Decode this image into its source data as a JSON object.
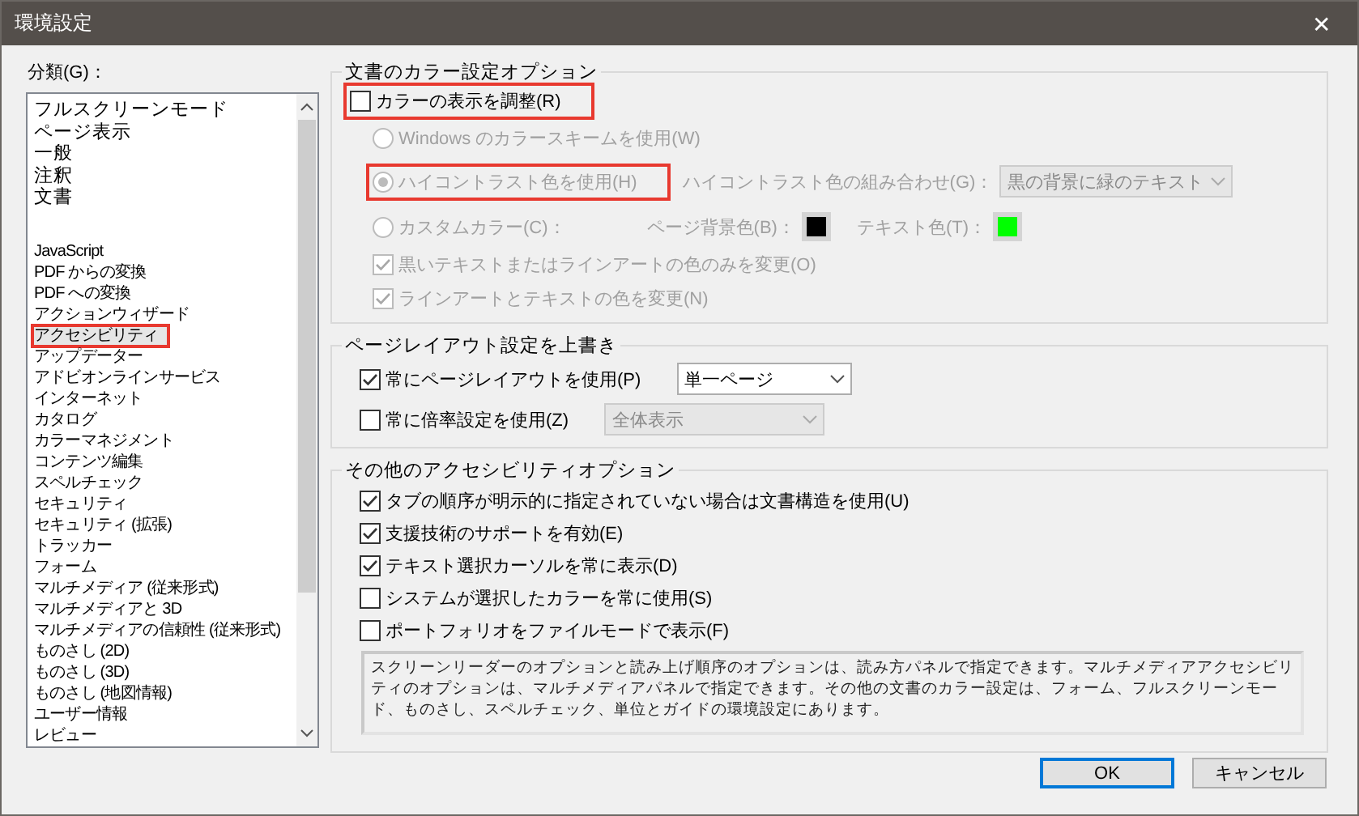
{
  "window": {
    "title": "環境設定",
    "close": "✕"
  },
  "category_label": "分類(G)：",
  "categories": [
    {
      "kind": "item",
      "label": "フルスクリーンモード",
      "selected": false,
      "highlighted": false
    },
    {
      "kind": "item",
      "label": "ページ表示",
      "selected": false,
      "highlighted": false
    },
    {
      "kind": "item",
      "label": "一般",
      "selected": false,
      "highlighted": false
    },
    {
      "kind": "item",
      "label": "注釈",
      "selected": false,
      "highlighted": false
    },
    {
      "kind": "item",
      "label": "文書",
      "selected": false,
      "highlighted": false
    },
    {
      "kind": "separator"
    },
    {
      "kind": "item",
      "label": "JavaScript",
      "selected": false,
      "highlighted": false
    },
    {
      "kind": "item",
      "label": "PDF からの変換",
      "selected": false,
      "highlighted": false
    },
    {
      "kind": "item",
      "label": "PDF への変換",
      "selected": false,
      "highlighted": false
    },
    {
      "kind": "item",
      "label": "アクションウィザード",
      "selected": false,
      "highlighted": false
    },
    {
      "kind": "item",
      "label": "アクセシビリティ",
      "selected": true,
      "highlighted": true
    },
    {
      "kind": "item",
      "label": "アップデーター",
      "selected": false,
      "highlighted": false
    },
    {
      "kind": "item",
      "label": "アドビオンラインサービス",
      "selected": false,
      "highlighted": false
    },
    {
      "kind": "item",
      "label": "インターネット",
      "selected": false,
      "highlighted": false
    },
    {
      "kind": "item",
      "label": "カタログ",
      "selected": false,
      "highlighted": false
    },
    {
      "kind": "item",
      "label": "カラーマネジメント",
      "selected": false,
      "highlighted": false
    },
    {
      "kind": "item",
      "label": "コンテンツ編集",
      "selected": false,
      "highlighted": false
    },
    {
      "kind": "item",
      "label": "スペルチェック",
      "selected": false,
      "highlighted": false
    },
    {
      "kind": "item",
      "label": "セキュリティ",
      "selected": false,
      "highlighted": false
    },
    {
      "kind": "item",
      "label": "セキュリティ (拡張)",
      "selected": false,
      "highlighted": false
    },
    {
      "kind": "item",
      "label": "トラッカー",
      "selected": false,
      "highlighted": false
    },
    {
      "kind": "item",
      "label": "フォーム",
      "selected": false,
      "highlighted": false
    },
    {
      "kind": "item",
      "label": "マルチメディア (従来形式)",
      "selected": false,
      "highlighted": false
    },
    {
      "kind": "item",
      "label": "マルチメディアと 3D",
      "selected": false,
      "highlighted": false
    },
    {
      "kind": "item",
      "label": "マルチメディアの信頼性 (従来形式)",
      "selected": false,
      "highlighted": false
    },
    {
      "kind": "item",
      "label": "ものさし (2D)",
      "selected": false,
      "highlighted": false
    },
    {
      "kind": "item",
      "label": "ものさし (3D)",
      "selected": false,
      "highlighted": false
    },
    {
      "kind": "item",
      "label": "ものさし (地図情報)",
      "selected": false,
      "highlighted": false
    },
    {
      "kind": "item",
      "label": "ユーザー情報",
      "selected": false,
      "highlighted": false
    },
    {
      "kind": "item",
      "label": "レビュー",
      "selected": false,
      "highlighted": false
    }
  ],
  "color_options": {
    "title": "文書のカラー設定オプション",
    "adjust": {
      "label": "カラーの表示を調整(R)",
      "checked": false,
      "highlighted": true
    },
    "radios": [
      {
        "kind": "plain",
        "label": "Windows のカラースキームを使用(W)",
        "selected": false,
        "disabled": true,
        "highlighted": false
      },
      {
        "kind": "combo",
        "label": "ハイコントラスト色を使用(H)",
        "selected": true,
        "disabled": true,
        "highlighted": true,
        "combo_label": "ハイコントラスト色の組み合わせ(G)：",
        "combo_value": "黒の背景に緑のテキスト"
      },
      {
        "kind": "colors",
        "label": "カスタムカラー(C)：",
        "selected": false,
        "disabled": true,
        "highlighted": false,
        "swatches": [
          {
            "label": "ページ背景色(B)：",
            "color": "#000000"
          },
          {
            "label": "テキスト色(T)：",
            "color": "#00ff00"
          }
        ]
      }
    ],
    "checkboxes": [
      {
        "label": "黒いテキストまたはラインアートの色のみを変更(O)",
        "checked": true,
        "disabled": true
      },
      {
        "label": "ラインアートとテキストの色を変更(N)",
        "checked": true,
        "disabled": true
      }
    ]
  },
  "page_layout": {
    "title": "ページレイアウト設定を上書き",
    "rows": [
      {
        "label": "常にページレイアウトを使用(P)",
        "checked": true,
        "select_value": "単一ページ",
        "select_disabled": false
      },
      {
        "label": "常に倍率設定を使用(Z)",
        "checked": false,
        "select_value": "全体表示",
        "select_disabled": true
      }
    ]
  },
  "other_options": {
    "title": "その他のアクセシビリティオプション",
    "checkboxes": [
      {
        "label": "タブの順序が明示的に指定されていない場合は文書構造を使用(U)",
        "checked": true
      },
      {
        "label": "支援技術のサポートを有効(E)",
        "checked": true
      },
      {
        "label": "テキスト選択カーソルを常に表示(D)",
        "checked": true
      },
      {
        "label": "システムが選択したカラーを常に使用(S)",
        "checked": false
      },
      {
        "label": "ポートフォリオをファイルモードで表示(F)",
        "checked": false
      }
    ],
    "note": "スクリーンリーダーのオプションと読み上げ順序のオプションは、読み方パネルで指定できます。マルチメディアアクセシビリティのオプションは、マルチメディアパネルで指定できます。その他の文書のカラー設定は、フォーム、フルスクリーンモード、ものさし、スペルチェック、単位とガイドの環境設定にあります。"
  },
  "buttons": [
    {
      "label": "OK",
      "default": true
    },
    {
      "label": "キャンセル",
      "default": false
    }
  ]
}
